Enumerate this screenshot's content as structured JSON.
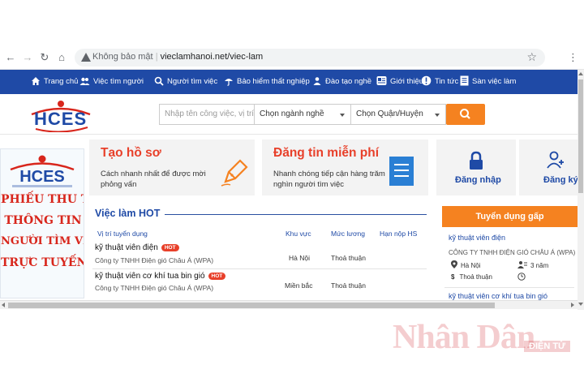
{
  "browser": {
    "security_label": "Không bảo mật",
    "url": "vieclamhanoi.net/viec-lam"
  },
  "colors": {
    "nav_blue": "#1f4aa6",
    "accent_orange": "#f58220",
    "title_red": "#e8402a"
  },
  "nav": {
    "items": [
      {
        "label": "Trang chủ",
        "icon": "home-icon"
      },
      {
        "label": "Việc tìm người",
        "icon": "users-icon"
      },
      {
        "label": "Người tìm việc",
        "icon": "search-person-icon"
      },
      {
        "label": "Bảo hiểm thất nghiệp",
        "icon": "umbrella-icon"
      },
      {
        "label": "Đào tạo nghề",
        "icon": "training-icon"
      },
      {
        "label": "Giới thiệu",
        "icon": "info-icon"
      },
      {
        "label": "Tin tức",
        "icon": "news-icon"
      },
      {
        "label": "Sàn việc làm",
        "icon": "document-icon"
      }
    ]
  },
  "search": {
    "placeholder": "Nhập tên công việc, vị trí...",
    "industry": "Chọn ngành nghề",
    "district": "Chọn Quận/Huyện"
  },
  "logo": {
    "text": "HCES"
  },
  "banner": {
    "lines": [
      "PHIẾU THU THẬP",
      "THÔNG TIN",
      "NGƯỜI TÌM VIỆC",
      "TRỰC TUYẾN"
    ]
  },
  "cards": [
    {
      "title": "Tạo hồ sơ",
      "desc": "Cách nhanh nhất để được mời phỏng vấn"
    },
    {
      "title": "Đăng tin miễn phí",
      "desc": "Nhanh chóng tiếp cận hàng trăm nghìn người tìm việc"
    }
  ],
  "auth": {
    "login": "Đăng nhập",
    "register": "Đăng ký"
  },
  "hot_jobs": {
    "title": "Việc làm HOT",
    "columns": [
      "Vị trí tuyển dụng",
      "Khu vực",
      "Mức lương",
      "Hạn nộp HS"
    ],
    "badge": "HOT",
    "rows": [
      {
        "title": "kỹ thuật viên điện",
        "company": "Công ty TNHH Điện gió Châu Á (WPA)",
        "location": "Hà Nội",
        "salary": "Thoả thuận"
      },
      {
        "title": "kỹ thuật viên cơ khí tua bin gió",
        "company": "Công ty TNHH Điện gió Châu Á (WPA)",
        "location": "Miền bắc",
        "salary": "Thoả thuận"
      }
    ]
  },
  "recruit": {
    "title": "Tuyển dụng gấp",
    "job1": "kỹ thuật viên điện",
    "company1": "CÔNG TY TNHH ĐIỆN GIÓ CHÂU Á (WPA)",
    "location1": "Hà Nội",
    "experience1": "3 năm",
    "salary1": "Thoả thuận",
    "job2": "kỹ thuật viên cơ khí tua bin gió"
  },
  "watermark": {
    "name": "Nhân Dân",
    "sub": "ĐIỆN TỬ"
  }
}
